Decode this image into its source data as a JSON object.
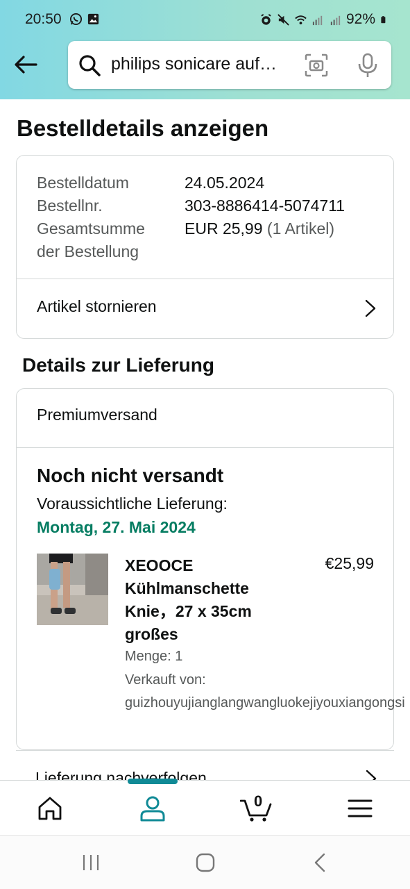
{
  "status_bar": {
    "time": "20:50",
    "battery": "92%"
  },
  "search": {
    "query": "philips sonicare auf…"
  },
  "page": {
    "title": "Bestelldetails anzeigen"
  },
  "order_summary": {
    "date_label": "Bestelldatum",
    "date_value": "24.05.2024",
    "number_label": "Bestellnr.",
    "number_value": "303-8886414-5074711",
    "total_label_line1": "Gesamtsumme",
    "total_label_line2": "der Bestellung",
    "total_value": "EUR 25,99",
    "total_items": "(1 Artikel)",
    "cancel_label": "Artikel stornieren"
  },
  "delivery": {
    "heading": "Details zur Lieferung",
    "shipping_method": "Premiumversand",
    "status": "Noch nicht versandt",
    "eta_label": "Voraussichtliche Lieferung:",
    "eta_date": "Montag, 27. Mai 2024",
    "item": {
      "title": "XEOOCE Kühlmanschette Knie，27 x 35cm großes",
      "price": "€25,99",
      "quantity": "Menge: 1",
      "sold_by_label": "Verkauft von:",
      "seller": "guizhouyujianglangwangluokejiyouxiangongsi"
    },
    "track_label": "Lieferung nachverfolgen"
  },
  "bottom_nav": {
    "cart_count": "0"
  },
  "colors": {
    "header_gradient_start": "#82d8e3",
    "header_gradient_end": "#a6e5cf",
    "accent_teal": "#108a96",
    "delivery_green": "#067d62"
  }
}
